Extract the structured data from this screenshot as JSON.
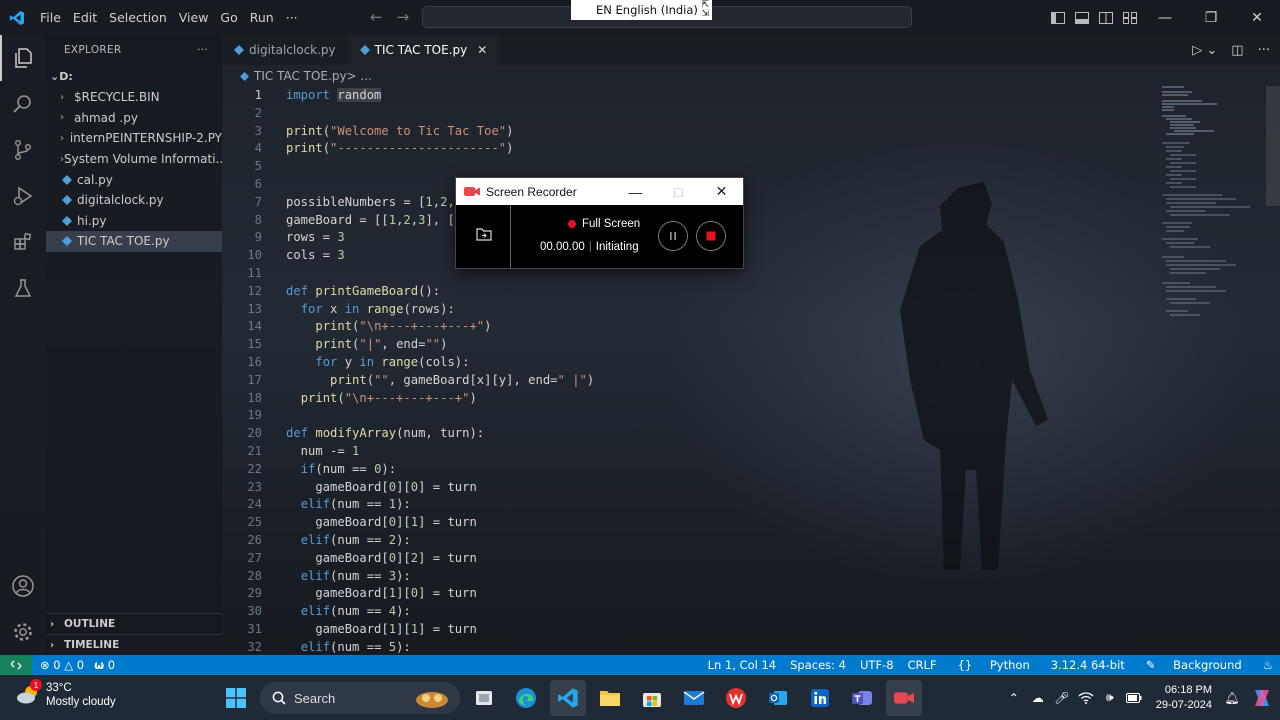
{
  "titlebar": {
    "menu": [
      "File",
      "Edit",
      "Selection",
      "View",
      "Go",
      "Run",
      "···"
    ],
    "language_popup": "EN English (India)"
  },
  "explorer": {
    "header": "EXPLORER",
    "more": "···",
    "root": "D:",
    "items": [
      {
        "type": "folder",
        "label": "$RECYCLE.BIN"
      },
      {
        "type": "folder",
        "label": "ahmad .py"
      },
      {
        "type": "folder",
        "label": "internPEINTERNSHIP-2.PY"
      },
      {
        "type": "folder",
        "label": "System Volume Informati..."
      },
      {
        "type": "file",
        "label": "cal.py"
      },
      {
        "type": "file",
        "label": "digitalclock.py"
      },
      {
        "type": "file",
        "label": "hi.py"
      },
      {
        "type": "file",
        "label": "TIC TAC TOE.py",
        "selected": true
      }
    ],
    "outline": "OUTLINE",
    "timeline": "TIMELINE"
  },
  "tabs": [
    {
      "label": "digitalclock.py",
      "active": false
    },
    {
      "label": "TIC TAC TOE.py",
      "active": true,
      "close": "✕"
    }
  ],
  "breadcrumb": {
    "file": "TIC TAC TOE.py",
    "rest": " > ..."
  },
  "editor": {
    "current_line": 1,
    "lines": [
      [
        {
          "t": "import",
          "c": "kw"
        },
        {
          "t": " "
        },
        {
          "t": "random",
          "c": "hl"
        }
      ],
      [],
      [
        {
          "t": "print",
          "c": "fn"
        },
        {
          "t": "("
        },
        {
          "t": "\"Welcome to Tic Tac Toe\"",
          "c": "str"
        },
        {
          "t": ")"
        }
      ],
      [
        {
          "t": "print",
          "c": "fn"
        },
        {
          "t": "("
        },
        {
          "t": "\"----------------------\"",
          "c": "str"
        },
        {
          "t": ")"
        }
      ],
      [],
      [],
      [
        {
          "t": "possibleNumbers = ["
        },
        {
          "t": "1",
          "c": "num"
        },
        {
          "t": ","
        },
        {
          "t": "2",
          "c": "num"
        },
        {
          "t": ","
        }
      ],
      [
        {
          "t": "gameBoard = [["
        },
        {
          "t": "1",
          "c": "num"
        },
        {
          "t": ","
        },
        {
          "t": "2",
          "c": "num"
        },
        {
          "t": ","
        },
        {
          "t": "3",
          "c": "num"
        },
        {
          "t": "], ["
        }
      ],
      [
        {
          "t": "rows = "
        },
        {
          "t": "3",
          "c": "num"
        }
      ],
      [
        {
          "t": "cols = "
        },
        {
          "t": "3",
          "c": "num"
        }
      ],
      [],
      [
        {
          "t": "def",
          "c": "kw"
        },
        {
          "t": " "
        },
        {
          "t": "printGameBoard",
          "c": "fn"
        },
        {
          "t": "():"
        }
      ],
      [
        {
          "t": "  "
        },
        {
          "t": "for",
          "c": "kw"
        },
        {
          "t": " x "
        },
        {
          "t": "in",
          "c": "kw"
        },
        {
          "t": " "
        },
        {
          "t": "range",
          "c": "fn"
        },
        {
          "t": "(rows):"
        }
      ],
      [
        {
          "t": "    "
        },
        {
          "t": "print",
          "c": "fn"
        },
        {
          "t": "("
        },
        {
          "t": "\"\\n+---+---+---+\"",
          "c": "str"
        },
        {
          "t": ")"
        }
      ],
      [
        {
          "t": "    "
        },
        {
          "t": "print",
          "c": "fn"
        },
        {
          "t": "("
        },
        {
          "t": "\"|\"",
          "c": "str"
        },
        {
          "t": ", end="
        },
        {
          "t": "\"\"",
          "c": "str"
        },
        {
          "t": ")"
        }
      ],
      [
        {
          "t": "    "
        },
        {
          "t": "for",
          "c": "kw"
        },
        {
          "t": " y "
        },
        {
          "t": "in",
          "c": "kw"
        },
        {
          "t": " "
        },
        {
          "t": "range",
          "c": "fn"
        },
        {
          "t": "(cols):"
        }
      ],
      [
        {
          "t": "      "
        },
        {
          "t": "print",
          "c": "fn"
        },
        {
          "t": "("
        },
        {
          "t": "\"\"",
          "c": "str"
        },
        {
          "t": ", gameBoard[x][y], end="
        },
        {
          "t": "\" |\"",
          "c": "str"
        },
        {
          "t": ")"
        }
      ],
      [
        {
          "t": "  "
        },
        {
          "t": "print",
          "c": "fn"
        },
        {
          "t": "("
        },
        {
          "t": "\"\\n+---+---+---+\"",
          "c": "str"
        },
        {
          "t": ")"
        }
      ],
      [],
      [
        {
          "t": "def",
          "c": "kw"
        },
        {
          "t": " "
        },
        {
          "t": "modifyArray",
          "c": "fn"
        },
        {
          "t": "(num, turn):"
        }
      ],
      [
        {
          "t": "  num -= "
        },
        {
          "t": "1",
          "c": "num"
        }
      ],
      [
        {
          "t": "  "
        },
        {
          "t": "if",
          "c": "kw"
        },
        {
          "t": "(num == "
        },
        {
          "t": "0",
          "c": "num"
        },
        {
          "t": "):"
        }
      ],
      [
        {
          "t": "    gameBoard["
        },
        {
          "t": "0",
          "c": "num"
        },
        {
          "t": "]["
        },
        {
          "t": "0",
          "c": "num"
        },
        {
          "t": "] = turn"
        }
      ],
      [
        {
          "t": "  "
        },
        {
          "t": "elif",
          "c": "kw"
        },
        {
          "t": "(num == "
        },
        {
          "t": "1",
          "c": "num"
        },
        {
          "t": "):"
        }
      ],
      [
        {
          "t": "    gameBoard["
        },
        {
          "t": "0",
          "c": "num"
        },
        {
          "t": "]["
        },
        {
          "t": "1",
          "c": "num"
        },
        {
          "t": "] = turn"
        }
      ],
      [
        {
          "t": "  "
        },
        {
          "t": "elif",
          "c": "kw"
        },
        {
          "t": "(num == "
        },
        {
          "t": "2",
          "c": "num"
        },
        {
          "t": "):"
        }
      ],
      [
        {
          "t": "    gameBoard["
        },
        {
          "t": "0",
          "c": "num"
        },
        {
          "t": "]["
        },
        {
          "t": "2",
          "c": "num"
        },
        {
          "t": "] = turn"
        }
      ],
      [
        {
          "t": "  "
        },
        {
          "t": "elif",
          "c": "kw"
        },
        {
          "t": "(num == "
        },
        {
          "t": "3",
          "c": "num"
        },
        {
          "t": "):"
        }
      ],
      [
        {
          "t": "    gameBoard["
        },
        {
          "t": "1",
          "c": "num"
        },
        {
          "t": "]["
        },
        {
          "t": "0",
          "c": "num"
        },
        {
          "t": "] = turn"
        }
      ],
      [
        {
          "t": "  "
        },
        {
          "t": "elif",
          "c": "kw"
        },
        {
          "t": "(num == "
        },
        {
          "t": "4",
          "c": "num"
        },
        {
          "t": "):"
        }
      ],
      [
        {
          "t": "    gameBoard["
        },
        {
          "t": "1",
          "c": "num"
        },
        {
          "t": "]["
        },
        {
          "t": "1",
          "c": "num"
        },
        {
          "t": "] = turn"
        }
      ],
      [
        {
          "t": "  "
        },
        {
          "t": "elif",
          "c": "kw"
        },
        {
          "t": "(num == "
        },
        {
          "t": "5",
          "c": "num"
        },
        {
          "t": "):"
        }
      ]
    ]
  },
  "recorder": {
    "title": "Screen Recorder",
    "mode": "Full Screen",
    "time": "00.00.00",
    "status": "Initiating"
  },
  "statusbar": {
    "errors": "0",
    "warnings": "0",
    "ports": "0",
    "position": "Ln 1, Col 14",
    "spaces": "Spaces: 4",
    "encoding": "UTF-8",
    "eol": "CRLF",
    "language": "Python",
    "interpreter": "3.12.4 64-bit",
    "background": "Background"
  },
  "taskbar": {
    "weather_temp": "33°C",
    "weather_desc": "Mostly cloudy",
    "weather_badge": "1",
    "search_label": "Search",
    "time": "06:18 PM",
    "date": "29-07-2024"
  },
  "colors": {
    "statusbar": "#007acc",
    "remote": "#16825d",
    "keyword": "#569cd6",
    "function": "#dcdcaa",
    "string": "#ce9178",
    "number": "#b5cea8",
    "record_red": "#e81123"
  }
}
